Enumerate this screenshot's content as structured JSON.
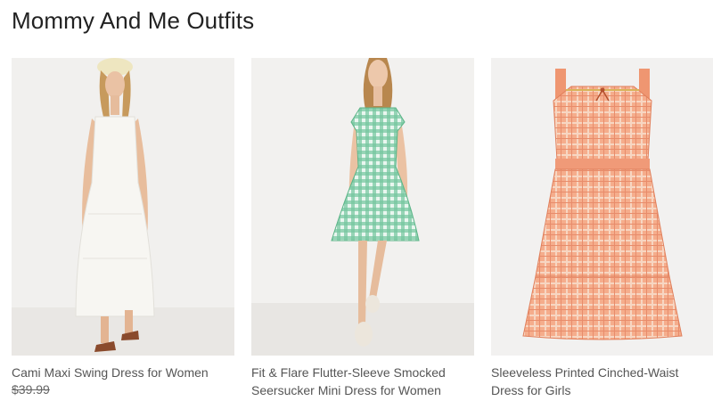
{
  "section": {
    "title": "Mommy And Me Outfits"
  },
  "products": [
    {
      "name": "Cami Maxi Swing Dress for Women",
      "price": "$39.99",
      "image": "woman-white-maxi-dress",
      "colors": {
        "dress": "#f4f3ee",
        "background": "#f1f0ee"
      }
    },
    {
      "name": "Fit & Flare Flutter-Sleeve Smocked Seersucker Mini Dress for Women",
      "price": "",
      "image": "woman-green-gingham-dress",
      "colors": {
        "dress": "#5bbf8f",
        "background": "#f2f1ef"
      }
    },
    {
      "name": "Sleeveless Printed Cinched-Waist Dress for Girls",
      "price": "",
      "image": "girls-orange-plaid-dress",
      "colors": {
        "dress": "#f2a180",
        "background": "#f2f1f0"
      }
    }
  ]
}
